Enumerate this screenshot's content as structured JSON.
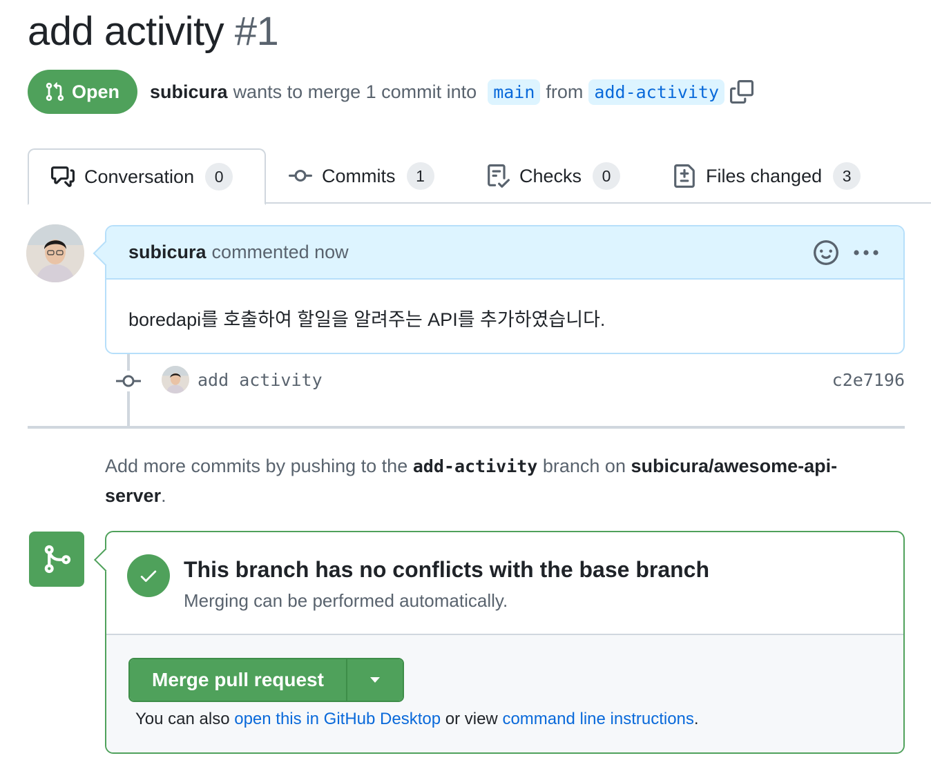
{
  "pr": {
    "title": "add activity",
    "number": "#1",
    "state": "Open",
    "author": "subicura",
    "merge_text": "wants to merge 1 commit into",
    "base_branch": "main",
    "from_text": "from",
    "head_branch": "add-activity"
  },
  "tabs": [
    {
      "label": "Conversation",
      "count": "0",
      "icon": "comment-discussion-icon"
    },
    {
      "label": "Commits",
      "count": "1",
      "icon": "git-commit-icon"
    },
    {
      "label": "Checks",
      "count": "0",
      "icon": "checklist-icon"
    },
    {
      "label": "Files changed",
      "count": "3",
      "icon": "file-diff-icon"
    }
  ],
  "comment": {
    "author": "subicura",
    "action": "commented now",
    "body": "boredapi를 호출하여 할일을 알려주는 API를 추가하였습니다."
  },
  "commit": {
    "message": "add activity",
    "sha": "c2e7196"
  },
  "hint": {
    "prefix": "Add more commits by pushing to the",
    "branch": "add-activity",
    "middle": "branch on",
    "repo": "subicura/awesome-api-server",
    "suffix": "."
  },
  "merge": {
    "title": "This branch has no conflicts with the base branch",
    "subtitle": "Merging can be performed automatically.",
    "button_label": "Merge pull request",
    "help_prefix": "You can also",
    "help_link1": "open this in GitHub Desktop",
    "help_middle": "or view",
    "help_link2": "command line instructions",
    "help_suffix": "."
  },
  "colors": {
    "success": "#4fa15b",
    "link": "#0969da",
    "comment_header": "#ddf4ff"
  }
}
